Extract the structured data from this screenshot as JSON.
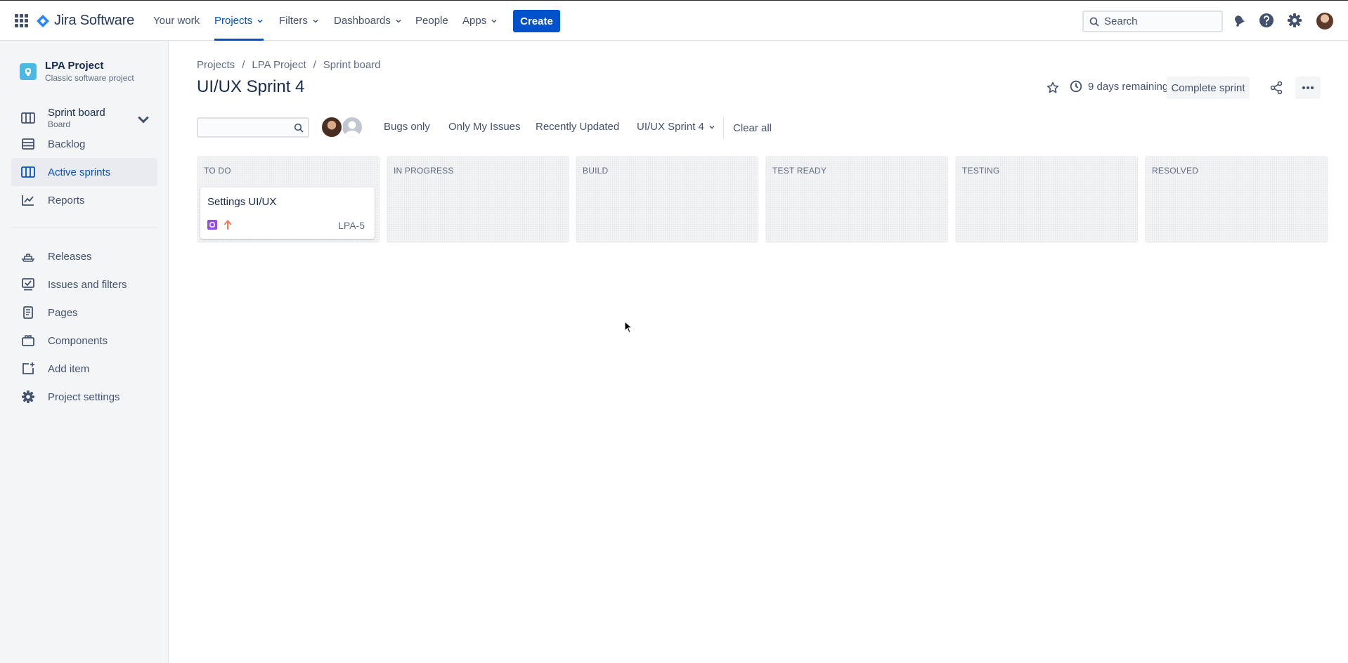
{
  "topnav": {
    "logo_text": "Jira Software",
    "items": [
      {
        "label": "Your work"
      },
      {
        "label": "Projects"
      },
      {
        "label": "Filters"
      },
      {
        "label": "Dashboards"
      },
      {
        "label": "People"
      },
      {
        "label": "Apps"
      }
    ],
    "create_label": "Create",
    "search_placeholder": "Search",
    "icons": [
      "notification-icon",
      "help-icon",
      "settings-icon"
    ]
  },
  "sidebar": {
    "project_name": "LPA Project",
    "project_type": "Classic software project",
    "items": [
      {
        "label": "Sprint board",
        "sub": "Board",
        "icon": "board-icon"
      },
      {
        "label": "Backlog",
        "icon": "backlog-icon"
      },
      {
        "label": "Active sprints",
        "icon": "sprint-icon"
      },
      {
        "label": "Reports",
        "icon": "reports-icon"
      },
      {
        "label": "Releases",
        "icon": "ship-icon"
      },
      {
        "label": "Issues and filters",
        "icon": "issues-icon"
      },
      {
        "label": "Pages",
        "icon": "page-icon"
      },
      {
        "label": "Components",
        "icon": "component-icon"
      },
      {
        "label": "Add item",
        "icon": "add-item-icon"
      },
      {
        "label": "Project settings",
        "icon": "gear-icon"
      }
    ]
  },
  "breadcrumbs": [
    "Projects",
    "LPA Project",
    "Sprint board"
  ],
  "breadcrumb_sep": "/",
  "page_title": "UI/UX Sprint 4",
  "header": {
    "remaining": "9 days remaining",
    "complete_label": "Complete sprint"
  },
  "filters": {
    "quick": [
      "Bugs only",
      "Only My Issues",
      "Recently Updated",
      "UI/UX Sprint 4"
    ],
    "clear_label": "Clear all"
  },
  "columns": [
    {
      "title": "TO DO"
    },
    {
      "title": "IN PROGRESS"
    },
    {
      "title": "BUILD"
    },
    {
      "title": "TEST READY"
    },
    {
      "title": "TESTING"
    },
    {
      "title": "RESOLVED"
    }
  ],
  "card": {
    "summary": "Settings UI/UX",
    "key": "LPA-5",
    "type_icon": "story-icon",
    "priority_icon": "priority-high-icon"
  },
  "colors": {
    "brand": "#0052cc",
    "text": "#172b4d",
    "sidebar_bg": "#f4f5f7",
    "priority": "#ff7452",
    "issue_type": "#904ee2"
  }
}
